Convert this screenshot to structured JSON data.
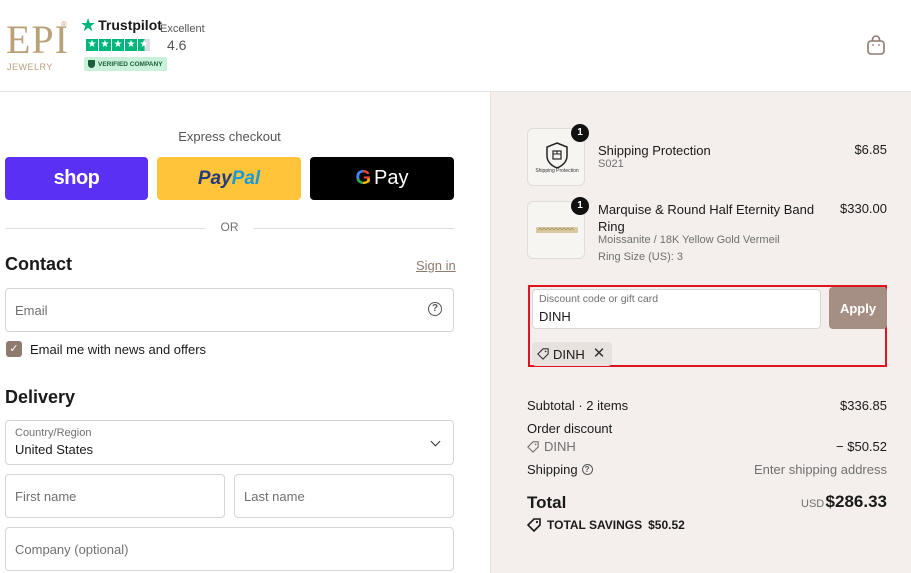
{
  "header": {
    "logo_text": "EPI",
    "logo_sub": "JEWELRY",
    "logo_reg": "®",
    "trustpilot": {
      "brand": "Trustpilot",
      "rating_word": "Excellent",
      "score": "4.6",
      "verified": "VERIFIED COMPANY"
    },
    "cart_icon": "shopping-bag-icon"
  },
  "express": {
    "title": "Express checkout",
    "shop_label": "shop",
    "paypal_label_1": "Pay",
    "paypal_label_2": "Pal",
    "gpay_g": "G",
    "gpay_label": "Pay",
    "or_label": "OR"
  },
  "contact": {
    "title": "Contact",
    "signin_label": "Sign in",
    "email_placeholder": "Email",
    "newsletter_label": "Email me with news and offers",
    "newsletter_checked": true
  },
  "delivery": {
    "title": "Delivery",
    "country_label": "Country/Region",
    "country_value": "United States",
    "first_name_placeholder": "First name",
    "last_name_placeholder": "Last name",
    "company_placeholder": "Company (optional)"
  },
  "order": {
    "items": [
      {
        "name": "Shipping Protection",
        "sub": "S021",
        "price": "$6.85",
        "qty": "1",
        "thumb_caption": "Shipping Protection"
      },
      {
        "name_line1": "Marquise & Round Half Eternity Band",
        "name_line2": "Ring",
        "sub1": "Moissanite / 18K Yellow Gold Vermeil",
        "sub2": "Ring Size (US): 3",
        "price": "$330.00",
        "qty": "1"
      }
    ],
    "discount": {
      "label": "Discount code or gift card",
      "value": "DINH",
      "apply_label": "Apply",
      "applied_code": "DINH"
    },
    "subtotal_label": "Subtotal · 2 items",
    "subtotal_value": "$336.85",
    "order_discount_label": "Order discount",
    "order_discount_code": "DINH",
    "order_discount_value": "− $50.52",
    "shipping_label": "Shipping",
    "shipping_value": "Enter shipping address",
    "total_label": "Total",
    "total_currency": "USD",
    "total_value": "$286.33",
    "savings_label": "TOTAL SAVINGS",
    "savings_value": "$50.52"
  },
  "colors": {
    "accent": "#8f7a70",
    "apply_button": "#a58f85",
    "panel_bg": "#f4efec",
    "shop_pay": "#5a31f4",
    "paypal": "#ffc439",
    "highlight_border": "#e0141e"
  }
}
